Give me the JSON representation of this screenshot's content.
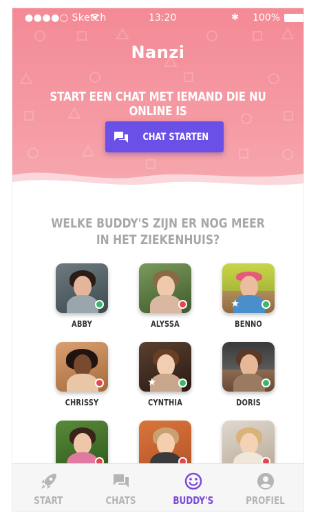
{
  "status_bar": {
    "carrier": "●●●●○ Sketch",
    "time": "13:20",
    "battery": "100%",
    "wifi_icon": "wifi-icon",
    "bluetooth_icon": "bluetooth-icon"
  },
  "header": {
    "brand": "Nanzi",
    "headline": "START EEN CHAT MET IEMAND DIE NU ONLINE IS",
    "cta_label": "CHAT STARTEN",
    "cta_icon": "chat-bubbles-icon",
    "colors": {
      "gradient_top": "#f48a96",
      "gradient_bottom": "#f7a9b0",
      "button": "#6a50e6"
    }
  },
  "section": {
    "title_line1": "WELKE BUDDY'S ZIJN ER NOG MEER",
    "title_line2": "IN HET ZIEKENHUIS?"
  },
  "buddies": [
    {
      "name": "ABBY",
      "status": "online",
      "favorite": false
    },
    {
      "name": "ALYSSA",
      "status": "offline",
      "favorite": false
    },
    {
      "name": "BENNO",
      "status": "online",
      "favorite": true
    },
    {
      "name": "CHRISSY",
      "status": "offline",
      "favorite": false
    },
    {
      "name": "CYNTHIA",
      "status": "online",
      "favorite": true
    },
    {
      "name": "DORIS",
      "status": "online",
      "favorite": false
    },
    {
      "name": "",
      "status": "offline",
      "favorite": false
    },
    {
      "name": "",
      "status": "offline",
      "favorite": false
    },
    {
      "name": "",
      "status": "offline",
      "favorite": false
    }
  ],
  "status_colors": {
    "online": "#3ab86a",
    "offline": "#e5454f"
  },
  "tabs": [
    {
      "label": "START",
      "icon": "rocket-icon",
      "active": false
    },
    {
      "label": "CHATS",
      "icon": "chat-bubbles-icon",
      "active": false
    },
    {
      "label": "BUDDY'S",
      "icon": "smiley-icon",
      "active": true
    },
    {
      "label": "PROFIEL",
      "icon": "person-icon",
      "active": false
    }
  ]
}
